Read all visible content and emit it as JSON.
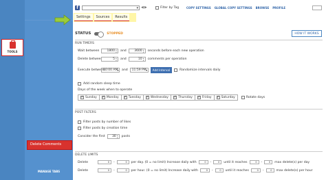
{
  "sidebar": {
    "tools_label": "TOOLS",
    "active_item": "Delete Comments",
    "manage_tabs": "MANAGE TABS"
  },
  "topbar": {
    "fb_glyph": "f",
    "filter_by_tag": "Filter by Tag",
    "links": [
      "COPY SETTINGS",
      "GLOBAL COPY SETTINGS",
      "BROWSE",
      "PROFILE"
    ]
  },
  "tabs": [
    "Settings",
    "Sources",
    "Results"
  ],
  "status": {
    "label": "STATUS",
    "value": "STOPPED",
    "how_button": "HOW IT WORKS"
  },
  "run_timers": {
    "title": "RUN TIMERS",
    "wait_label": "Wait between",
    "wait_from": "1800",
    "and": "and",
    "wait_to": "3600",
    "wait_suffix": "seconds before each new operation",
    "delete_label": "Delete between",
    "delete_from": "5",
    "delete_to": "10",
    "delete_suffix": "comments per operation",
    "execute_label": "Execute between",
    "exec_from": "10:00 AM",
    "exec_to": "11:59 PM",
    "add_interval": "Add Interval",
    "randomize": "Randomize intervals daily",
    "sleep": "Add random sleep time",
    "days_title": "Days of the week when to operate",
    "days": [
      "Sunday",
      "Monday",
      "Tuesday",
      "Wednesday",
      "Thursday",
      "Friday",
      "Saturday"
    ],
    "rotate": "Rotate days"
  },
  "post_filters": {
    "title": "POST FILTERS",
    "by_likes": "Filter posts by number of likes",
    "by_time": "Filter posts by creation time",
    "consider": "Consider the first",
    "consider_value": "30",
    "posts": "posts"
  },
  "delete_limits": {
    "title": "DELETE LIMITS",
    "delete": "Delete",
    "per_day": "per day. (0 = no limit) Increase daily with",
    "per_hour": "per hour. (0 = no limit) Increase daily with",
    "until": "until it reaches",
    "max_deletes": "max delete(s) per day",
    "max_deletes_hour": "max delete(s) per hour",
    "zero": "0"
  }
}
